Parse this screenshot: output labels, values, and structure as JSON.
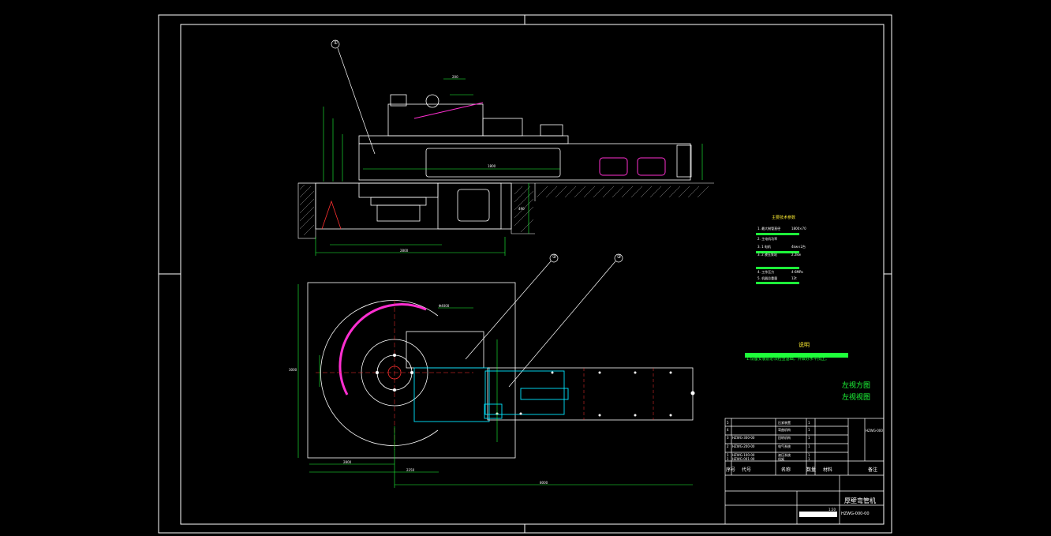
{
  "balloons": [
    "①",
    "②",
    "③"
  ],
  "notes": {
    "title": "说明",
    "text": "1.设备安装前必须检查基础，并做好水平找正。"
  },
  "specs": {
    "title": "主要技术参数",
    "rows": [
      {
        "label": "1. 最大制管直径",
        "value": "1800×70"
      },
      {
        "label": "2. 主电机功率",
        "value": ""
      },
      {
        "label": "3. 1 电机",
        "value": "4kw×2台"
      },
      {
        "label": "3. 2 液压泵站",
        "value": "2.2kw"
      },
      {
        "label": "4. 工作压力",
        "value": "4-6MPa"
      },
      {
        "label": "5. 机器总重量",
        "value": "12t"
      }
    ]
  },
  "handwritten": [
    "左视方图",
    "左视视图"
  ],
  "dimensions": {
    "top_width": "2800",
    "top_length": "1800",
    "plan_x1": "2800",
    "plan_x2": "2250",
    "plan_total": "8000",
    "plan_height": "3000",
    "plan_dia": "Φ4000",
    "rise": "490",
    "top_small": "200"
  },
  "title_block": {
    "drawing_name": "厚壁弯管机",
    "drawing_code": "HZWG-000-00",
    "headers": [
      "序号",
      "代号",
      "名称",
      "数量",
      "材料",
      "备注"
    ],
    "right_tag": "HZWG-000",
    "scale": "1:20",
    "bom": [
      {
        "no": "5",
        "code": "",
        "name": "压紧装置",
        "qty": "1"
      },
      {
        "no": "4",
        "code": "",
        "name": "弯曲机构",
        "qty": "1"
      },
      {
        "no": "3",
        "code": "HZWG-300-00",
        "name": "回转机构",
        "qty": "1"
      },
      {
        "no": "2",
        "code": "HZWG-200-00",
        "name": "电气系统",
        "qty": "1"
      },
      {
        "no": "1",
        "code": "HZWG-100-00",
        "name": "液压系统",
        "qty": "1"
      },
      {
        "no": "1",
        "code": "HZWG-001-00",
        "name": "机架",
        "qty": "1"
      }
    ]
  },
  "colors": {
    "background": "#000000",
    "lines": "#ffffff",
    "dimension": "#1eff3a",
    "accent": "#ff2fd1",
    "cyan": "#00e5ff",
    "yellow": "#ffee33",
    "red": "#ff3030"
  }
}
